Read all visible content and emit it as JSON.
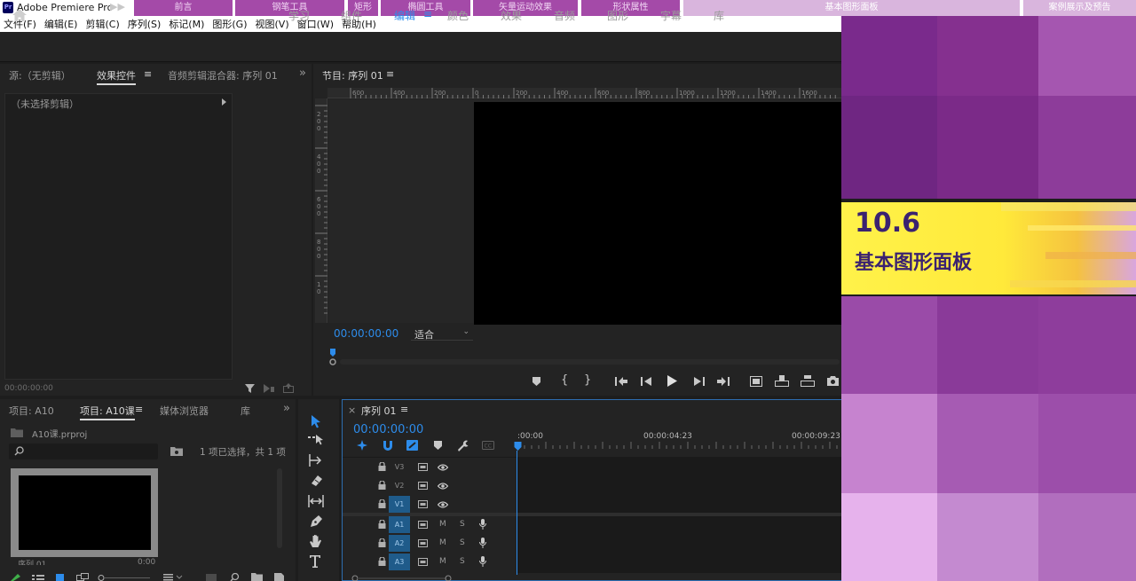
{
  "app": {
    "title": "Adobe Premiere Pro",
    "logo": "Pr",
    "nav_arrows": "▶▶"
  },
  "chapters": [
    {
      "label": "前言"
    },
    {
      "label": "钢笔工具"
    },
    {
      "label": "矩形"
    },
    {
      "label": "椭圆工具"
    },
    {
      "label": "矢量运动效果"
    },
    {
      "label": "形状属性"
    },
    {
      "label": "基本图形面板"
    },
    {
      "label": "案例展示及预告"
    }
  ],
  "menu": [
    "文件(F)",
    "编辑(E)",
    "剪辑(C)",
    "序列(S)",
    "标记(M)",
    "图形(G)",
    "视图(V)",
    "窗口(W)",
    "帮助(H)"
  ],
  "workspaces": {
    "items": [
      "学习",
      "组件",
      "编辑",
      "颜色",
      "效果",
      "音频",
      "图形",
      "字幕",
      "库"
    ],
    "active": "编辑",
    "menu_glyph": "≡"
  },
  "source_panel": {
    "tabs": [
      "源:（无剪辑）",
      "效果控件",
      "音频剪辑混合器: 序列 01"
    ],
    "active_tab": "效果控件",
    "menu_glyph": "≡",
    "overflow": "»",
    "no_clip": "（未选择剪辑）",
    "timecode": "00:00:00:00"
  },
  "program_panel": {
    "title": "节目: 序列 01",
    "menu_glyph": "≡",
    "timecode": "00:00:00:00",
    "fit_label": "适合",
    "ruler_h": [
      "600",
      "400",
      "200",
      "0",
      "200",
      "400",
      "600",
      "800",
      "1000",
      "1200",
      "1400",
      "1600"
    ],
    "ruler_v": [
      "2\n0\n0",
      "4\n0\n0",
      "6\n0\n0",
      "8\n0\n0",
      "1\n0"
    ]
  },
  "project_panel": {
    "tabs": [
      "项目: A10",
      "项目: A10课",
      "媒体浏览器",
      "库"
    ],
    "active_tab": "项目: A10课",
    "menu_glyph": "≡",
    "overflow": "»",
    "file_name": "A10课.prproj",
    "selection_status": "1 项已选择，共 1 项",
    "clip_name": "序列 01",
    "clip_duration": "0:00"
  },
  "timeline": {
    "close_glyph": "×",
    "title": "序列 01",
    "menu_glyph": "≡",
    "timecode": "00:00:00:00",
    "ruler": [
      ":00:00",
      "00:00:04:23",
      "00:00:09:23"
    ],
    "video_tracks": [
      "V3",
      "V2",
      "V1"
    ],
    "audio_tracks": [
      "A1",
      "A2",
      "A3"
    ],
    "mute": "M",
    "solo": "S"
  },
  "overlay": {
    "number": "10.6",
    "title": "基本图形面板"
  },
  "colors": {
    "accent_blue": "#2d8ceb",
    "banner_yellow": "#ffe93a",
    "overlay_purple": "#7a2a8c"
  }
}
